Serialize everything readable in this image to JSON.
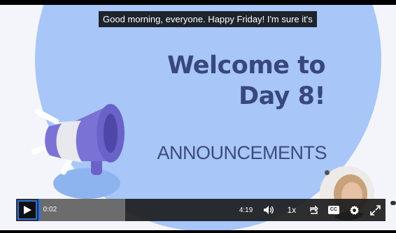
{
  "slide": {
    "title_line1": "Welcome to",
    "title_line2": "Day 8!",
    "subtitle": "ANNOUNCEMENTS"
  },
  "caption": "Good morning, everyone. Happy Friday! I'm sure it's",
  "player": {
    "current_time": "0:02",
    "duration": "4:19",
    "speed": "1x",
    "cc_label": "CC",
    "buffered_fraction": 0.44,
    "played_fraction": 0.01
  },
  "colors": {
    "accent": "#2d6fe0",
    "title": "#38477d",
    "circle": "#a8c6f7",
    "megaphone": "#7b72d6"
  },
  "icons": [
    "play-icon",
    "volume-icon",
    "repeat-icon",
    "closed-captions-icon",
    "gear-icon",
    "fullscreen-icon",
    "megaphone-icon"
  ]
}
